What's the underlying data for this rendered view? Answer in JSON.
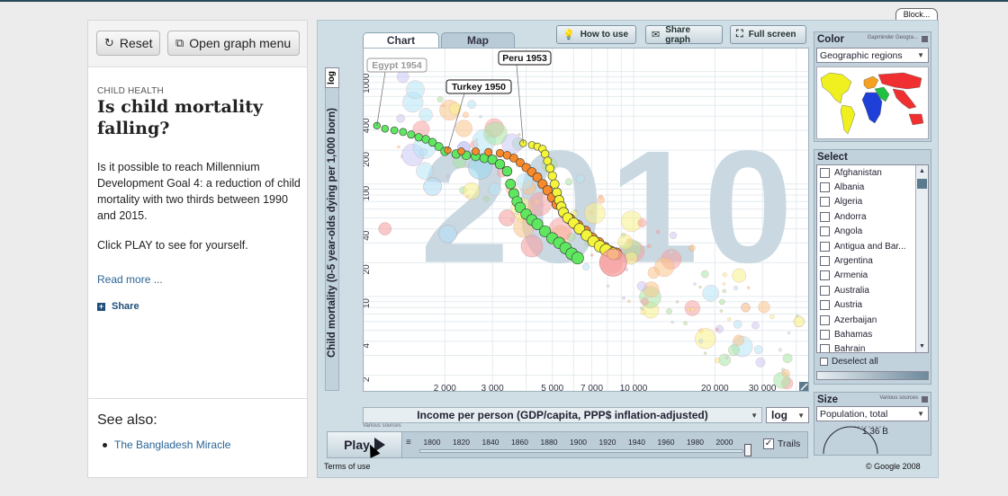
{
  "blocker": "Block...",
  "left": {
    "reset_label": "Reset",
    "menu_label": "Open graph menu",
    "category": "CHILD HEALTH",
    "title": "Is child mortality falling?",
    "description": "Is it possible to reach Millennium Development Goal 4: a reduction of child mortality with two thirds between 1990 and 2015.",
    "description2": "Click PLAY to see for yourself.",
    "read_more": "Read more ...",
    "share": "Share",
    "see_also": "See also:",
    "see_also_items": [
      "The Bangladesh Miracle"
    ]
  },
  "tabs": {
    "chart": "Chart",
    "map": "Map"
  },
  "toolbar": {
    "how_to_use": "How to use",
    "share_graph": "Share graph",
    "full_screen": "Full screen"
  },
  "y_axis": {
    "scale": "log",
    "label": "Child mortality (0-5 year-olds dying per 1,000 born)",
    "sources": "Various sources"
  },
  "x_axis": {
    "label": "Income per person (GDP/capita, PPP$ inflation-adjusted)",
    "scale": "log",
    "sources": "Various sources"
  },
  "play": {
    "label": "Play"
  },
  "timeline": {
    "years": [
      "1800",
      "1820",
      "1840",
      "1860",
      "1880",
      "1900",
      "1920",
      "1940",
      "1960",
      "1980",
      "2000"
    ]
  },
  "trails_label": "Trails",
  "terms": "Terms of use",
  "copyright": "© Google 2008",
  "color_panel": {
    "title": "Color",
    "source": "Gapminder Geogra...",
    "value": "Geographic regions"
  },
  "select_panel": {
    "title": "Select",
    "countries": [
      "Afghanistan",
      "Albania",
      "Algeria",
      "Andorra",
      "Angola",
      "Antigua and Bar...",
      "Argentina",
      "Armenia",
      "Australia",
      "Austria",
      "Azerbaijan",
      "Bahamas",
      "Bahrain"
    ],
    "deselect_all": "Deselect all"
  },
  "size_panel": {
    "title": "Size",
    "source": "Various sources",
    "value": "Population, total",
    "max": "1.36 B"
  },
  "chart_data": {
    "type": "scatter",
    "year_watermark": "2010",
    "x_ticks": [
      "2 000",
      "3 000",
      "5 000",
      "7 000",
      "10 000",
      "20 000",
      "30 000"
    ],
    "y_ticks": [
      "1000",
      "400",
      "200",
      "100",
      "40",
      "20",
      "10",
      "4",
      "2"
    ],
    "xlim": [
      1000,
      45000
    ],
    "ylim": [
      1.4,
      1600
    ],
    "annotations": [
      "Egypt 1954",
      "Turkey 1950",
      "Peru 1953"
    ]
  }
}
